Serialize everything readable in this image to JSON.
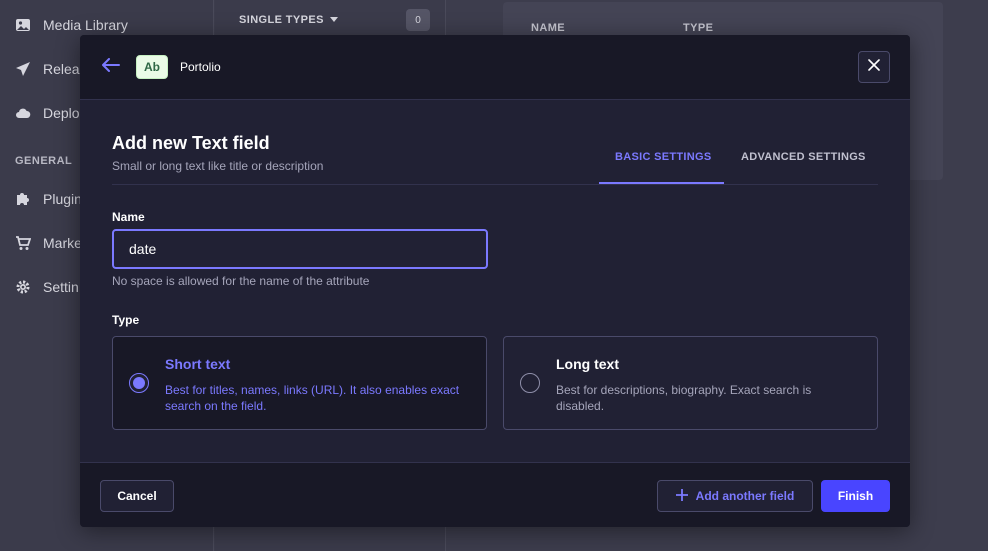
{
  "background": {
    "sidebar": {
      "items": [
        {
          "label": "Media Library",
          "icon": "image-icon"
        },
        {
          "label": "Releas",
          "icon": "paper-plane-icon"
        },
        {
          "label": "Deplo",
          "icon": "cloud-icon"
        },
        {
          "label": "Plugin",
          "icon": "puzzle-icon"
        },
        {
          "label": "Marke",
          "icon": "cart-icon"
        },
        {
          "label": "Settin",
          "icon": "gear-icon"
        }
      ],
      "section_general": "GENERAL"
    },
    "subnav": {
      "single_types_label": "SINGLE TYPES",
      "single_types_count": "0"
    },
    "table": {
      "col_name": "NAME",
      "col_type": "TYPE"
    }
  },
  "modal": {
    "header": {
      "badge": "Ab",
      "breadcrumb": "Portolio"
    },
    "title": "Add new Text field",
    "subtitle": "Small or long text like title or description",
    "tabs": [
      {
        "label": "BASIC SETTINGS",
        "active": true
      },
      {
        "label": "ADVANCED SETTINGS",
        "active": false
      }
    ],
    "name_field": {
      "label": "Name",
      "value": "date",
      "hint": "No space is allowed for the name of the attribute"
    },
    "type_field": {
      "label": "Type",
      "options": [
        {
          "title": "Short text",
          "description": "Best for titles, names, links (URL). It also enables exact search on the field.",
          "selected": true
        },
        {
          "title": "Long text",
          "description": "Best for descriptions, biography. Exact search is disabled.",
          "selected": false
        }
      ]
    },
    "footer": {
      "cancel_label": "Cancel",
      "add_another_label": "Add another field",
      "finish_label": "Finish"
    }
  },
  "colors": {
    "accent": "#7b79ff",
    "primary": "#4945ff",
    "modal_bg": "#212134",
    "header_bg": "#181826"
  }
}
